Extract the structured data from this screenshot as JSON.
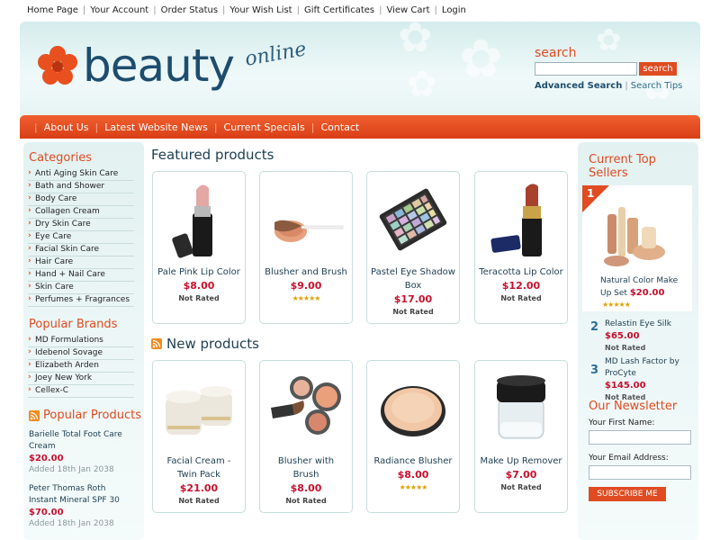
{
  "topnav": {
    "links": [
      "Home Page",
      "Your Account",
      "Order Status",
      "Your Wish List",
      "Gift Certificates",
      "View Cart",
      "Login"
    ]
  },
  "logo": {
    "word": "beauty",
    "suffix": "online"
  },
  "search": {
    "title": "search",
    "button": "search",
    "advanced": "Advanced Search",
    "tips": "Search Tips"
  },
  "rednav": {
    "items": [
      "About Us",
      "Latest Website News",
      "Current Specials",
      "Contact"
    ]
  },
  "categories": {
    "title": "Categories",
    "items": [
      "Anti Aging Skin Care",
      "Bath and Shower",
      "Body Care",
      "Collagen Cream",
      "Dry Skin Care",
      "Eye Care",
      "Facial Skin Care",
      "Hair Care",
      "Hand + Nail Care",
      "Skin Care",
      "Perfumes + Fragrances"
    ]
  },
  "brands": {
    "title": "Popular Brands",
    "items": [
      "MD Formulations",
      "Idebenol Sovage",
      "Elizabeth Arden",
      "Joey New York",
      "Cellex-C"
    ]
  },
  "popular_products": {
    "title": "Popular Products",
    "items": [
      {
        "name": "Barielle Total Foot Care Cream",
        "price": "$20.00",
        "date": "Added 18th Jan 2038"
      },
      {
        "name": "Peter Thomas Roth Instant Mineral SPF 30",
        "price": "$70.00",
        "date": "Added 18th Jan 2038"
      }
    ]
  },
  "featured": {
    "title": "Featured products",
    "items": [
      {
        "name": "Pale Pink Lip Color",
        "price": "$8.00",
        "rating": "Not Rated"
      },
      {
        "name": "Blusher and Brush",
        "price": "$9.00",
        "rating": "stars"
      },
      {
        "name": "Pastel Eye Shadow Box",
        "price": "$17.00",
        "rating": "Not Rated"
      },
      {
        "name": "Teracotta Lip Color",
        "price": "$12.00",
        "rating": "Not Rated"
      }
    ]
  },
  "newproducts": {
    "title": "New products",
    "items": [
      {
        "name": "Facial Cream - Twin Pack",
        "price": "$21.00",
        "rating": "Not Rated"
      },
      {
        "name": "Blusher with Brush",
        "price": "$8.00",
        "rating": "Not Rated"
      },
      {
        "name": "Radiance Blusher",
        "price": "$8.00",
        "rating": "stars"
      },
      {
        "name": "Make Up Remover",
        "price": "$7.00",
        "rating": "Not Rated"
      }
    ]
  },
  "top_sellers": {
    "title": "Current Top Sellers",
    "first": {
      "rank": "1",
      "name": "Natural Color Make Up Set",
      "price": "$20.00"
    },
    "others": [
      {
        "rank": "2",
        "name": "Relastin Eye Silk",
        "price": "$65.00",
        "rating": "Not Rated"
      },
      {
        "rank": "3",
        "name": "MD Lash Factor by ProCyte",
        "price": "$145.00",
        "rating": "Not Rated"
      }
    ]
  },
  "newsletter": {
    "title": "Our Newsletter",
    "first_name_label": "Your First Name:",
    "email_label": "Your Email Address:",
    "button": "SUBSCRIBE ME"
  },
  "stars_glyph": "★★★★★",
  "colors": {
    "accent": "#e04b21",
    "price": "#c8102e",
    "navy": "#1d4d6e",
    "panel": "#e3f1f1"
  }
}
